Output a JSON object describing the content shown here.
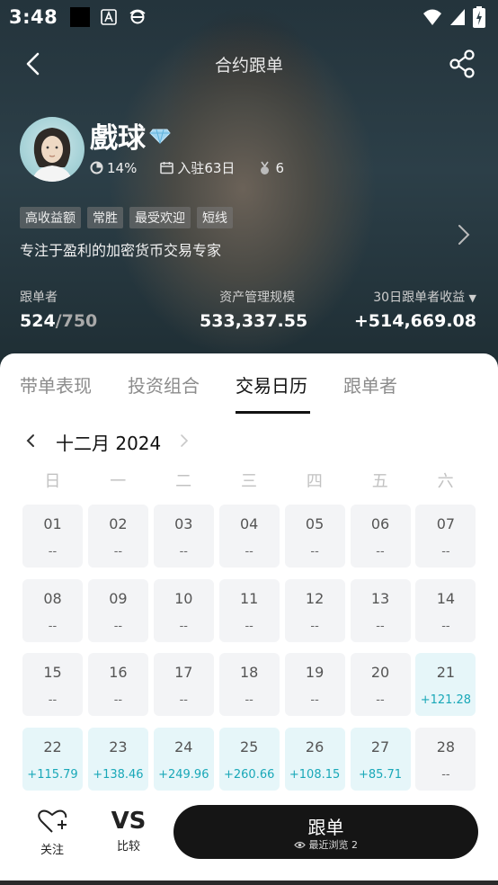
{
  "status_bar": {
    "time": "3:48"
  },
  "nav": {
    "title": "合约跟单"
  },
  "trader": {
    "name": "戲球",
    "win_rate": "14%",
    "days_joined": "入驻63日",
    "followers_icon_count": "6",
    "tags": [
      "高收益额",
      "常胜",
      "最受欢迎",
      "短线"
    ],
    "bio": "专注于盈利的加密货币交易专家"
  },
  "stats": {
    "followers_label": "跟单者",
    "followers_current": "524",
    "followers_max": "/750",
    "aum_label": "资产管理规模",
    "aum_value": "533,337.55",
    "pnl_label": "30日跟单者收益",
    "pnl_value": "+514,669.08"
  },
  "tabs": [
    {
      "label": "带单表现"
    },
    {
      "label": "投资组合"
    },
    {
      "label": "交易日历"
    },
    {
      "label": "跟单者"
    }
  ],
  "active_tab": "交易日历",
  "calendar": {
    "month_label": "十二月 2024",
    "weekdays": [
      "日",
      "一",
      "二",
      "三",
      "四",
      "五",
      "六"
    ],
    "days": [
      {
        "d": "01",
        "v": "--"
      },
      {
        "d": "02",
        "v": "--"
      },
      {
        "d": "03",
        "v": "--"
      },
      {
        "d": "04",
        "v": "--"
      },
      {
        "d": "05",
        "v": "--"
      },
      {
        "d": "06",
        "v": "--"
      },
      {
        "d": "07",
        "v": "--"
      },
      {
        "d": "08",
        "v": "--"
      },
      {
        "d": "09",
        "v": "--"
      },
      {
        "d": "10",
        "v": "--"
      },
      {
        "d": "11",
        "v": "--"
      },
      {
        "d": "12",
        "v": "--"
      },
      {
        "d": "13",
        "v": "--"
      },
      {
        "d": "14",
        "v": "--"
      },
      {
        "d": "15",
        "v": "--"
      },
      {
        "d": "16",
        "v": "--"
      },
      {
        "d": "17",
        "v": "--"
      },
      {
        "d": "18",
        "v": "--"
      },
      {
        "d": "19",
        "v": "--"
      },
      {
        "d": "20",
        "v": "--"
      },
      {
        "d": "21",
        "v": "+121.28"
      },
      {
        "d": "22",
        "v": "+115.79"
      },
      {
        "d": "23",
        "v": "+138.46"
      },
      {
        "d": "24",
        "v": "+249.96"
      },
      {
        "d": "25",
        "v": "+260.66"
      },
      {
        "d": "26",
        "v": "+108.15"
      },
      {
        "d": "27",
        "v": "+85.71"
      },
      {
        "d": "28",
        "v": "--"
      }
    ]
  },
  "footer": {
    "follow_label": "关注",
    "compare_icon_text": "VS",
    "compare_label": "比较",
    "copy_button_label": "跟单",
    "recent_views_label": "最近浏览",
    "recent_views_count": "2"
  },
  "colors": {
    "positive": "#19a8b8",
    "positive_bg": "#e6f6f9",
    "cell_bg": "#f3f4f6",
    "primary_button": "#151515"
  }
}
